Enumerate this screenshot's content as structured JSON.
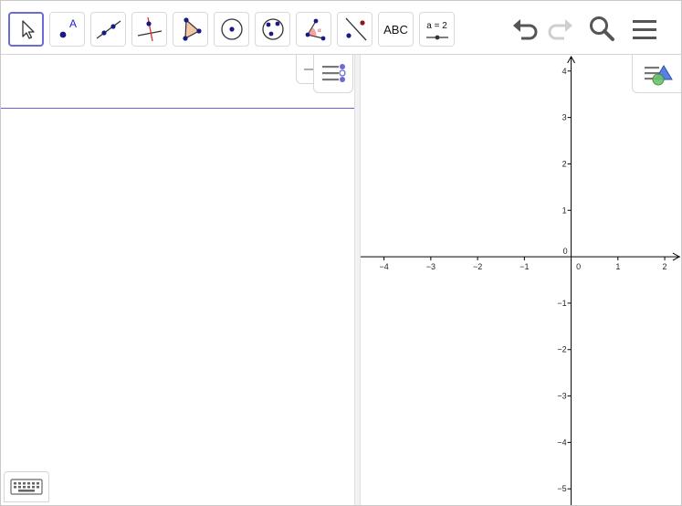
{
  "toolbar": {
    "tools": [
      {
        "name": "move-tool",
        "icon": "arrow-pointer-icon"
      },
      {
        "name": "point-tool",
        "icon": "point-icon",
        "label": "A"
      },
      {
        "name": "line-tool",
        "icon": "line-through-points-icon"
      },
      {
        "name": "perpendicular-line-tool",
        "icon": "perpendicular-line-icon"
      },
      {
        "name": "polygon-tool",
        "icon": "polygon-icon"
      },
      {
        "name": "circle-tool",
        "icon": "circle-center-point-icon"
      },
      {
        "name": "circle-three-points-tool",
        "icon": "circle-three-points-icon"
      },
      {
        "name": "angle-tool",
        "icon": "angle-icon",
        "label": "α"
      },
      {
        "name": "reflect-tool",
        "icon": "reflect-about-line-icon"
      },
      {
        "name": "text-tool",
        "icon": "text-icon",
        "label": "ABC"
      },
      {
        "name": "slider-tool",
        "icon": "slider-icon",
        "label": "a = 2"
      }
    ],
    "actions": [
      {
        "name": "undo-button",
        "icon": "undo-icon"
      },
      {
        "name": "redo-button",
        "icon": "redo-icon"
      },
      {
        "name": "search-button",
        "icon": "search-icon"
      },
      {
        "name": "menu-button",
        "icon": "hamburger-menu-icon"
      }
    ]
  },
  "algebra": {
    "input_value": "",
    "input_placeholder": ""
  },
  "graphics": {
    "chart_data": {
      "type": "scatter",
      "x_ticks": [
        "−4",
        "−3",
        "−2",
        "−1",
        "0",
        "1",
        "2"
      ],
      "y_ticks": [
        "4",
        "3",
        "2",
        "1",
        "0",
        "−1",
        "−2",
        "−3",
        "−4",
        "−5"
      ],
      "xlim": [
        -4.5,
        2.35
      ],
      "ylim": [
        -5.35,
        4.35
      ],
      "grid": false
    }
  },
  "colors": {
    "accent": "#6b6bd6",
    "point": "#1a1a80",
    "algebra_line": "#6666cc",
    "polygon_fill": "#f2c6a6",
    "angle_fill": "#e85a5a"
  }
}
